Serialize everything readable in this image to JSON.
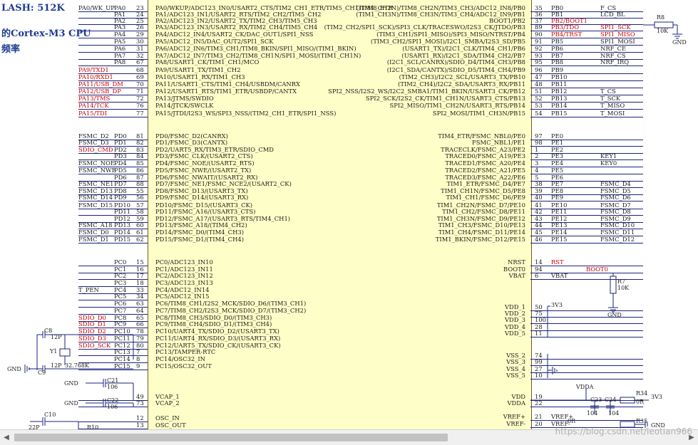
{
  "header": {
    "title_line1": "LASH:  512K",
    "title_line2": "的Cortex-M3 CPU",
    "title_line3": "频率"
  },
  "left_pins": [
    {
      "net": "PA0/WK_UP",
      "port": "PA0",
      "num": "23",
      "fn": "PA0/WKUP/ADC123_IN0/USART2_CTS/TIM2_CH1_ETR/TIM5_CH1/TIM8_ETR",
      "net_red": false
    },
    {
      "net": "",
      "port": "PA1",
      "num": "24",
      "fn": "PA1/ADC123_IN1/USART2_RTS/TIM2_CH2/TIM5_CH2",
      "net_red": false
    },
    {
      "net": "",
      "port": "PA2",
      "num": "25",
      "fn": "PA2/ADC123_IN2/USART2_TX/TIM2_CH3/TIM5_CH3",
      "net_red": false
    },
    {
      "net": "",
      "port": "PA3",
      "num": "26",
      "fn": "PA3/ADC123_IN3/USART2_RX/TIM2_CH4/TIM5_CH4",
      "net_red": false
    },
    {
      "net": "",
      "port": "PA4",
      "num": "29",
      "fn": "PA4/ADC12_IN4/USART2_CK/DAC_OUT1/SPI1_NSS",
      "net_red": false
    },
    {
      "net": "",
      "port": "PA5",
      "num": "30",
      "fn": "PA5/ADC12_IN5/DAC_OUT2/SPI1_SCK",
      "net_red": false
    },
    {
      "net": "",
      "port": "PA6",
      "num": "31",
      "fn": "PA6/ADC12_IN6/TIM3_CH1/TIM8_BKIN/SPI1_MISO/(TIM1_BKIN)",
      "net_red": false
    },
    {
      "net": "",
      "port": "PA7",
      "num": "32",
      "fn": "PA7/ADC12_IN7/TIM3_CH2/TIM8_CH1N/SPI1_MOSI/(TIM1_CH1N)",
      "net_red": false
    },
    {
      "net": "",
      "port": "PA8",
      "num": "67",
      "fn": "PA8/USART1_CK/TIM1_CH1/MCO",
      "net_red": false
    },
    {
      "net": "PA9/TXD1",
      "port": "",
      "num": "68",
      "fn": "PA9/USART1_TX/TIM1_CH2",
      "net_red": true
    },
    {
      "net": "PA10/RXD1",
      "port": "",
      "num": "69",
      "fn": "PA10/USART1_RX/TIM1_CH3",
      "net_red": true
    },
    {
      "net": "PA11/USB_DM",
      "port": "",
      "num": "70",
      "fn": "PA11/USART1_CTS/TIM1_CH4/USBDM/CANRX",
      "net_red": true
    },
    {
      "net": "PA12/USB_DP",
      "port": "",
      "num": "71",
      "fn": "PA12/USART1_RTS/TIM1_ETR/USBDP/CANTX",
      "net_red": true
    },
    {
      "net": "PA13/TMS",
      "port": "",
      "num": "72",
      "fn": "PA13/JTMS/SWDIO",
      "net_red": true
    },
    {
      "net": "PA14/TCK",
      "port": "",
      "num": "76",
      "fn": "PA14/JTCK/SWCLK",
      "net_red": true
    },
    {
      "net": "PA15/TDI",
      "port": "",
      "num": "77",
      "fn": "PA15/JTDI/I2S3_WS/SPI3_NSS/(TIM2_CH1_ETR/SPI1_NSS)",
      "net_red": true
    },
    {
      "net": "FSMC_D2",
      "port": "PD0",
      "num": "81",
      "fn": "PD0/FSMC_D2(CANRX)",
      "net_red": false
    },
    {
      "net": "FSMC_D3",
      "port": "PD1",
      "num": "82",
      "fn": "PD1/FSMC_D3(CANTX)",
      "net_red": false
    },
    {
      "net": "SDIO_CMD",
      "port": "PD2",
      "num": "83",
      "fn": "PD2/UART5_RX/TIM3_ETR/SDIO_CMD",
      "net_red": true
    },
    {
      "net": "",
      "port": "PD3",
      "num": "84",
      "fn": "PD3/FSMC_CLK/(USART2_CTS)",
      "net_red": false
    },
    {
      "net": "FSMC_NOE",
      "port": "PD4",
      "num": "85",
      "fn": "PD4/FSMC_NOE/(USART2_RTS)",
      "net_red": false
    },
    {
      "net": "FSMC_NWE",
      "port": "PD5",
      "num": "86",
      "fn": "PD5/FSMC_NWE/(USART2_TX)",
      "net_red": false
    },
    {
      "net": "",
      "port": "PD6",
      "num": "87",
      "fn": "PD6/FSMC_NWAIT/(USART2_RX)",
      "net_red": false
    },
    {
      "net": "FSMC_NE1",
      "port": "PD7",
      "num": "88",
      "fn": "PD7/FSMC_NE1/FSMC_NCE2/(USART2_CK)",
      "net_red": false
    },
    {
      "net": "FSMC_D13",
      "port": "PD8",
      "num": "55",
      "fn": "PD8/FSMC_D13/(USART3_TX)",
      "net_red": false
    },
    {
      "net": "FSMC_D14",
      "port": "PD9",
      "num": "56",
      "fn": "PD9/FSMC_D14/(USART3_RX)",
      "net_red": false
    },
    {
      "net": "FSMC_D15",
      "port": "PD10",
      "num": "57",
      "fn": "PD10/FSMC_D15/(USART3_CK)",
      "net_red": false
    },
    {
      "net": "",
      "port": "PD11",
      "num": "58",
      "fn": "PD11/FSMC_A16/(USART3_CTS)",
      "net_red": false
    },
    {
      "net": "",
      "port": "PD12",
      "num": "59",
      "fn": "PD12/FSMC_A17/(USART3_RTS/TIM4_CH1)",
      "net_red": false
    },
    {
      "net": "FSMC_A18",
      "port": "PD13",
      "num": "60",
      "fn": "PD13/FSMC_A18/(TIM4_CH2)",
      "net_red": false
    },
    {
      "net": "FSMC_D0",
      "port": "PD14",
      "num": "61",
      "fn": "PD14/FSMC_D0/(TIM4_CH3)",
      "net_red": false
    },
    {
      "net": "FSMC_D1",
      "port": "PD15",
      "num": "62",
      "fn": "PD15/FSMC_D1/(TIM4_CH4)",
      "net_red": false
    },
    {
      "net": "",
      "port": "PC0",
      "num": "15",
      "fn": "PC0/ADC123_IN10",
      "net_red": false
    },
    {
      "net": "",
      "port": "PC1",
      "num": "16",
      "fn": "PC1/ADC123_IN11",
      "net_red": false
    },
    {
      "net": "",
      "port": "PC2",
      "num": "17",
      "fn": "PC2/ADC123_IN12",
      "net_red": false
    },
    {
      "net": "",
      "port": "PC3",
      "num": "18",
      "fn": "PC3/ADC123_IN13",
      "net_red": false
    },
    {
      "net": "T_PEN",
      "port": "PC4",
      "num": "33",
      "fn": "PC4/ADC12_IN14",
      "net_red": false
    },
    {
      "net": "",
      "port": "PC5",
      "num": "34",
      "fn": "PC5/ADC12_IN15",
      "net_red": false
    },
    {
      "net": "",
      "port": "PC6",
      "num": "63",
      "fn": "PC6/TIM8_CH1/I2S2_MCK/SDIO_D6/(TIM3_CH1)",
      "net_red": false
    },
    {
      "net": "",
      "port": "PC7",
      "num": "64",
      "fn": "PC7/TIM8_CH2/I2S3_MCK/SDIO_D7/(TIM3_CH2)",
      "net_red": false
    },
    {
      "net": "SDIO_D0",
      "port": "PC8",
      "num": "65",
      "fn": "PC8/TIM8_CH3/SDIO_D0/(TIM3_CH3)",
      "net_red": true
    },
    {
      "net": "SDIO_D1",
      "port": "PC9",
      "num": "66",
      "fn": "PC9/TIM8_CH4/SDIO_D1/(TIM3_CH4)",
      "net_red": true
    },
    {
      "net": "SDIO_D2",
      "port": "PC10",
      "num": "78",
      "fn": "PC10/UART4_TX/SDIO_D2/(USART3_TX)",
      "net_red": true
    },
    {
      "net": "SDIO_D3",
      "port": "PC11",
      "num": "79",
      "fn": "PC11/UART4_RX/SDIO_D3/(USART3_RX)",
      "net_red": true
    },
    {
      "net": "SDIO_SCK",
      "port": "PC12",
      "num": "80",
      "fn": "PC12/UART5_TX/SDIO_CK/(USART3_CK)",
      "net_red": true
    },
    {
      "net": "",
      "port": "PC13",
      "num": "7",
      "fn": "PC13/TAMPER-RTC",
      "net_red": false
    },
    {
      "net": "",
      "port": "PC14",
      "num": "8",
      "fn": "PC14/OSC32_IN",
      "net_red": false
    },
    {
      "net": "",
      "port": "PC15",
      "num": "9",
      "fn": "PC15/OSC32_OUT",
      "net_red": false
    },
    {
      "net": "",
      "port": "",
      "num": "49",
      "fn": "VCAP_1",
      "net_red": false
    },
    {
      "net": "",
      "port": "",
      "num": "73",
      "fn": "VCAP_2",
      "net_red": false
    },
    {
      "net": "",
      "port": "",
      "num": "12",
      "fn": "OSC_IN",
      "net_red": false
    },
    {
      "net": "",
      "port": "",
      "num": "13",
      "fn": "OSC_OUT",
      "net_red": false
    }
  ],
  "right_pins": [
    {
      "fn": "(TIM1_CH2N)/TIM8_CH2N/TIM3_CH3/ADC12_IN8/PB0",
      "num": "35",
      "port": "PB0",
      "net": "F_CS",
      "net_red": false
    },
    {
      "fn": "(TIM1_CH3N)/TIM8_CH3N/TIM3_CH4/ADC12_IN9/PB1",
      "num": "36",
      "port": "PB1",
      "net": "LCD_BL",
      "net_red": false
    },
    {
      "fn": "BOOT1/PB2",
      "num": "37",
      "port": "PB2/BOOT1",
      "net": "",
      "net_red": true
    },
    {
      "fn": "(TIM2_CH2/SPI1_SCK)/SPI3_CLK/TRACESWO/I2S3_CK/JTDO/PB3",
      "num": "89",
      "port": "PB3/TDO",
      "net": "SPI1_SCK",
      "net_red": true
    },
    {
      "fn": "(TIM3_CH1/SPI1_MISO)/SPI3_MISO/NTRST/PB4",
      "num": "90",
      "port": "PB4/TRST",
      "net": "SPI1_MISO",
      "net_red": true
    },
    {
      "fn": "(TIM3_CH2/SPI1_MOSI)/I2C1_SMBA/I2S3_SD/PB5",
      "num": "91",
      "port": "PB5",
      "net": "SPI1_MOSI",
      "net_red": false
    },
    {
      "fn": "(USART1_TX)/I2C1_CLK/TIM4_CH1/PB6",
      "num": "92",
      "port": "PB6",
      "net": "NRF_CE",
      "net_red": false
    },
    {
      "fn": "(USART1_RX)/I2C1_SDA/TIM4_CH2/PB7",
      "num": "93",
      "port": "PB7",
      "net": "NRF_CS",
      "net_red": false
    },
    {
      "fn": "(I2C1_SCL/CANRX)/SDIO_D4/TIM4_CH3/PB8",
      "num": "95",
      "port": "PB8",
      "net": "NRF_IRQ",
      "net_red": false
    },
    {
      "fn": "(I2C1_SDA/CANTX)/SDIO_D5/TIM4_CH4/PB9",
      "num": "96",
      "port": "PB9",
      "net": "",
      "net_red": false
    },
    {
      "fn": "(TIM2_CH3)/I2C2_SCL/USART3_TX/PB10",
      "num": "47",
      "port": "PB10",
      "net": "",
      "net_red": false
    },
    {
      "fn": "(TIM2_CH4)/I2C2_SDA/USART3_RX/PB11",
      "num": "48",
      "port": "PB11",
      "net": "",
      "net_red": false
    },
    {
      "fn": "SPI2_NSS/I2S2_WS/I2C2_SMBA1/TIM1_BKIN/USART3_CK/PB12",
      "num": "51",
      "port": "PB12",
      "net": "T_CS",
      "net_red": false
    },
    {
      "fn": "SPI2_SCK/I2S2_CK/TIM1_CH1N/USART3_CTS/PB13",
      "num": "52",
      "port": "PB13",
      "net": "T_SCK",
      "net_red": false
    },
    {
      "fn": "SPI2_MISO/TIM1_CH2N/USART3_RTS/PB14",
      "num": "53",
      "port": "PB14",
      "net": "T_MISO",
      "net_red": false
    },
    {
      "fn": "SPI2_MOSI/TIM1_CH3N/PB15",
      "num": "54",
      "port": "PB15",
      "net": "T_MOSI",
      "net_red": false
    },
    {
      "fn": "TIM4_ETR/FSMC_NBL0/PE0",
      "num": "97",
      "port": "PE0",
      "net": "",
      "net_red": false
    },
    {
      "fn": "FSMC_NBL1/PE1",
      "num": "98",
      "port": "PE1",
      "net": "",
      "net_red": false
    },
    {
      "fn": "TRACECLK/FSMC_A23/PE2",
      "num": "1",
      "port": "PE2",
      "net": "",
      "net_red": false
    },
    {
      "fn": "TRACED0/FSMC_A19/PE3",
      "num": "2",
      "port": "PE3",
      "net": "KEY1",
      "net_red": false
    },
    {
      "fn": "TRACED1/FSMC_A20/PE4",
      "num": "3",
      "port": "PE4",
      "net": "KEY0",
      "net_red": false
    },
    {
      "fn": "TRACED2/FSMC_A21/PE5",
      "num": "4",
      "port": "PE5",
      "net": "",
      "net_red": false
    },
    {
      "fn": "TRACED3/FSMC_A22/PE6",
      "num": "5",
      "port": "PE6",
      "net": "",
      "net_red": false
    },
    {
      "fn": "TIM1_ETR/FSMC_D4/PE7",
      "num": "38",
      "port": "PE7",
      "net": "FSMC_D4",
      "net_red": false
    },
    {
      "fn": "TIM1_CH1N/FSMC_D5/PE8",
      "num": "39",
      "port": "PE8",
      "net": "FSMC_D5",
      "net_red": false
    },
    {
      "fn": "TIM1_CH1/FSMC_D6/PE9",
      "num": "40",
      "port": "PE9",
      "net": "FSMC_D6",
      "net_red": false
    },
    {
      "fn": "TIM1_CH2N/FSMC_D7/PE10",
      "num": "41",
      "port": "PE10",
      "net": "FSMC_D7",
      "net_red": false
    },
    {
      "fn": "TIM1_CH2/FSMC_D8/PE11",
      "num": "42",
      "port": "PE11",
      "net": "FSMC_D8",
      "net_red": false
    },
    {
      "fn": "TIM1_CH3N/FSMC_D9/PE12",
      "num": "43",
      "port": "PE12",
      "net": "FSMC_D9",
      "net_red": false
    },
    {
      "fn": "TIM1_CH3/FSMC_D10/PE13",
      "num": "44",
      "port": "PE13",
      "net": "FSMC_D10",
      "net_red": false
    },
    {
      "fn": "TIM1_CH4/FSMC_D11/PE14",
      "num": "45",
      "port": "PE14",
      "net": "FSMC_D11",
      "net_red": false
    },
    {
      "fn": "TIM1_BKIN/FSMC_D12/PE15",
      "num": "46",
      "port": "PE15",
      "net": "FSMC_D12",
      "net_red": false
    },
    {
      "fn": "NRST",
      "num": "14",
      "port": "RST",
      "net": "",
      "net_red": true
    },
    {
      "fn": "BOOT0",
      "num": "94",
      "port": "",
      "net": "BOOT0",
      "net_red": true
    },
    {
      "fn": "VBAT",
      "num": "6",
      "port": "VBAT",
      "net": "",
      "net_red": false
    },
    {
      "fn": "VDD_1",
      "num": "50",
      "port": "",
      "net": "",
      "net_red": false
    },
    {
      "fn": "VDD_2",
      "num": "75",
      "port": "",
      "net": "",
      "net_red": false
    },
    {
      "fn": "VDD_3",
      "num": "100",
      "port": "",
      "net": "",
      "net_red": false
    },
    {
      "fn": "VDD_4",
      "num": "28",
      "port": "",
      "net": "",
      "net_red": false
    },
    {
      "fn": "VDD_5",
      "num": "11",
      "port": "",
      "net": "",
      "net_red": false
    },
    {
      "fn": "VSS_2",
      "num": "74",
      "port": "",
      "net": "",
      "net_red": false
    },
    {
      "fn": "VSS_3",
      "num": "99",
      "port": "",
      "net": "",
      "net_red": false
    },
    {
      "fn": "VSS_4",
      "num": "27",
      "port": "",
      "net": "",
      "net_red": false
    },
    {
      "fn": "VSS_5",
      "num": "10",
      "port": "",
      "net": "",
      "net_red": false
    },
    {
      "fn": "VDD",
      "num": "19",
      "port": "",
      "net": "",
      "net_red": false
    },
    {
      "fn": "VDDA",
      "num": "22",
      "port": "",
      "net": "",
      "net_red": false
    },
    {
      "fn": "VREF+",
      "num": "21",
      "port": "VREF+",
      "net": "",
      "net_red": false
    },
    {
      "fn": "VREF-",
      "num": "20",
      "port": "VREF-",
      "net": "",
      "net_red": false
    }
  ],
  "components": {
    "r8": "R8",
    "r8_val": "10K",
    "gnd": "GND",
    "r7": "R7",
    "r7_val": "10K",
    "v33": "3V3",
    "vdda": "VDDA",
    "c23": "C23",
    "c23_val": "104",
    "c24": "C24",
    "c24_val": "104",
    "r34": "R34",
    "r34_val": "0R",
    "r35": "R35",
    "c8": "C8",
    "c8_val": "12P",
    "c9": "C9",
    "c9_val": "12P",
    "y1": "Y1",
    "y1_val": "32.768K",
    "c21": "C21",
    "c21_val": "106",
    "c22": "C22",
    "c22_val": "106",
    "c10": "C10",
    "c10_val": "22P",
    "r10": "R10",
    "vref_r": "0R"
  },
  "watermark": "https://blog.csdn.net/leotian966"
}
